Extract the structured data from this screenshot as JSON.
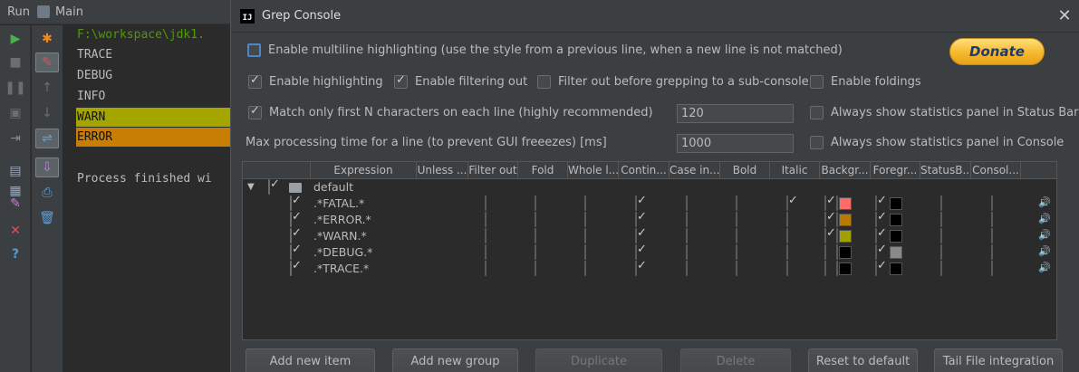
{
  "run_panel": {
    "tab_label": "Run",
    "config_name": "Main",
    "console_lines": [
      {
        "text": "F:\\workspace\\jdk1.",
        "kind": "path"
      },
      {
        "text": "TRACE",
        "kind": "plain"
      },
      {
        "text": "DEBUG",
        "kind": "plain"
      },
      {
        "text": "INFO",
        "kind": "plain"
      },
      {
        "text": "WARN",
        "kind": "warn",
        "bg": "#a5a500"
      },
      {
        "text": "ERROR",
        "kind": "error",
        "bg": "#c87d05"
      },
      {
        "text": "",
        "kind": "plain"
      },
      {
        "text": "Process finished wi",
        "kind": "plain"
      }
    ]
  },
  "dialog": {
    "title": "Grep Console",
    "donate_label": "Donate",
    "options": {
      "multiline": "Enable multiline highlighting (use the style from a previous line, when a new line is not matched)",
      "highlighting": "Enable highlighting",
      "filtering": "Enable filtering out",
      "filter_before_grep": "Filter out before grepping to a sub-console",
      "foldings": "Enable foldings",
      "match_first_n": "Match only first N characters on each line (highly recommended)",
      "match_first_n_value": "120",
      "always_status_bar": "Always show statistics panel in Status Bar",
      "max_time_label": "Max processing time for a line (to prevent GUI freeezes) [ms]",
      "max_time_value": "1000",
      "always_console": "Always show statistics panel in Console"
    },
    "table": {
      "columns": [
        "Expression",
        "Unless ...",
        "Filter out",
        "Fold",
        "Whole l...",
        "Contin...",
        "Case in...",
        "Bold",
        "Italic",
        "Backgr...",
        "Foregr...",
        "StatusB...",
        "Consol..."
      ],
      "group_name": "default",
      "rows": [
        {
          "expr": ".*FATAL.*",
          "whole": true,
          "bold": true,
          "bg_on": true,
          "bg": "#ff6b6b",
          "fg_on": true,
          "fg": "#000000"
        },
        {
          "expr": ".*ERROR.*",
          "whole": true,
          "bold": false,
          "bg_on": true,
          "bg": "#b87a00",
          "fg_on": true,
          "fg": "#000000"
        },
        {
          "expr": ".*WARN.*",
          "whole": true,
          "bold": false,
          "bg_on": true,
          "bg": "#a0a000",
          "fg_on": true,
          "fg": "#000000"
        },
        {
          "expr": ".*DEBUG.*",
          "whole": true,
          "bold": false,
          "bg_on": false,
          "bg": "#000000",
          "fg_on": true,
          "fg": "#8a8a8a"
        },
        {
          "expr": ".*TRACE.*",
          "whole": true,
          "bold": false,
          "bg_on": false,
          "bg": "#000000",
          "fg_on": true,
          "fg": "#000000"
        }
      ]
    },
    "buttons": {
      "add_item": "Add new item",
      "add_group": "Add new group",
      "duplicate": "Duplicate",
      "delete": "Delete",
      "reset": "Reset to default",
      "tail": "Tail File integration"
    }
  }
}
